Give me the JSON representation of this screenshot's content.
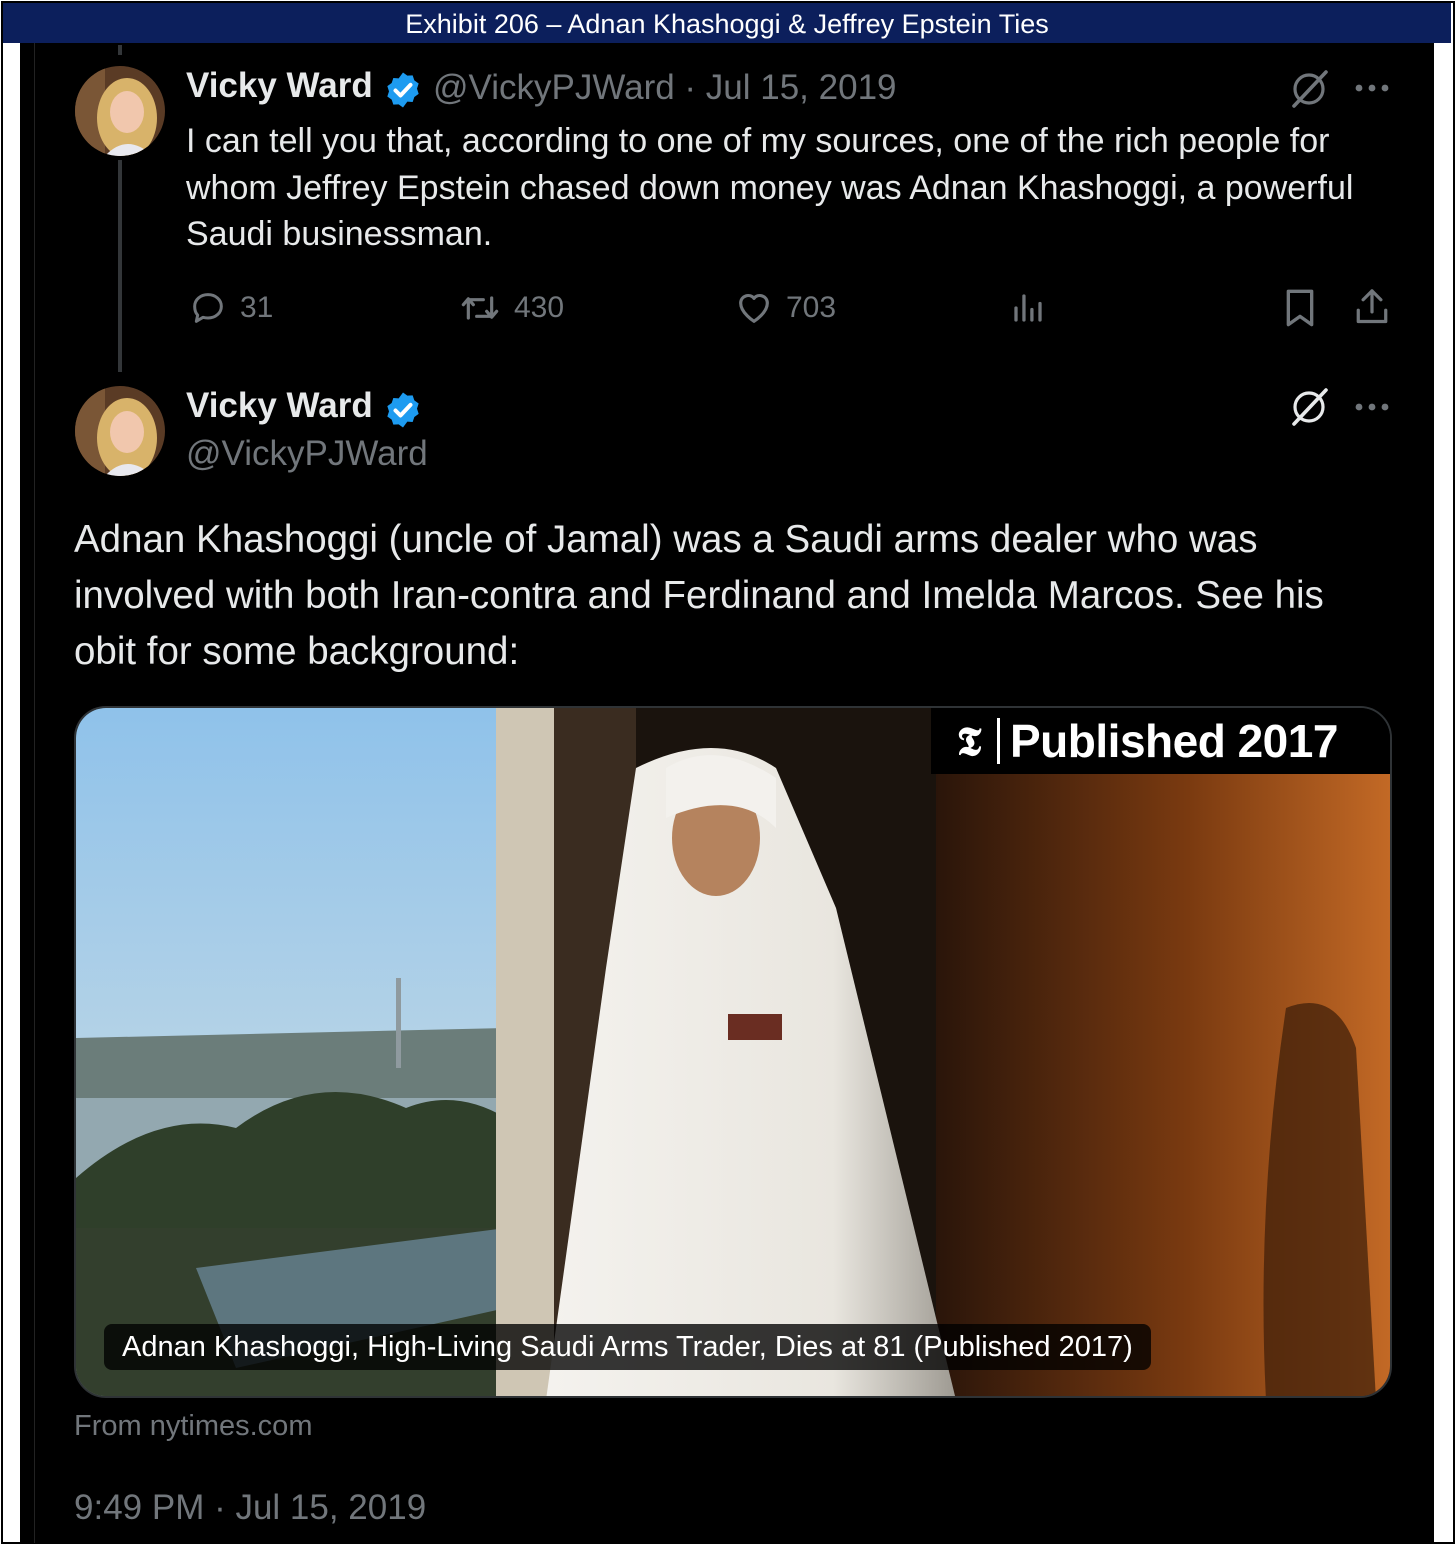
{
  "exhibit": {
    "title": "Exhibit 206 – Adnan Khashoggi & Jeffrey Epstein Ties"
  },
  "tweet1": {
    "author_name": "Vicky Ward",
    "handle_date": "@VickyPJWard · Jul 15, 2019",
    "text": "I can tell you that, according to one of my sources, one of the rich people for whom Jeffrey Epstein chased down money was Adnan Khashoggi, a powerful Saudi businessman.",
    "replies": "31",
    "reposts": "430",
    "likes": "703"
  },
  "tweet2": {
    "author_name": "Vicky Ward",
    "handle": "@VickyPJWard",
    "text": "Adnan Khashoggi (uncle of Jamal) was a Saudi arms dealer who was involved with both Iran-contra and Ferdinand and Imelda Marcos. See his obit for some background:",
    "card": {
      "logo": "𝕿",
      "badge": "Published 2017",
      "caption": "Adnan Khashoggi, High-Living Saudi Arms Trader, Dies at 81 (Published 2017)",
      "source": "From nytimes.com"
    },
    "timestamp": "9:49 PM · Jul 15, 2019"
  },
  "icons": {
    "grok": "grok-icon",
    "more": "more-icon",
    "reply": "reply-icon",
    "repost": "repost-icon",
    "like": "heart-icon",
    "views": "views-icon",
    "bookmark": "bookmark-icon",
    "share": "share-icon",
    "verified": "verified-badge-icon"
  },
  "colors": {
    "background": "#000000",
    "text": "#e7e9ea",
    "secondary": "#71767b",
    "verified": "#1d9bf0",
    "exhibit_bar": "#0c1f5c"
  }
}
